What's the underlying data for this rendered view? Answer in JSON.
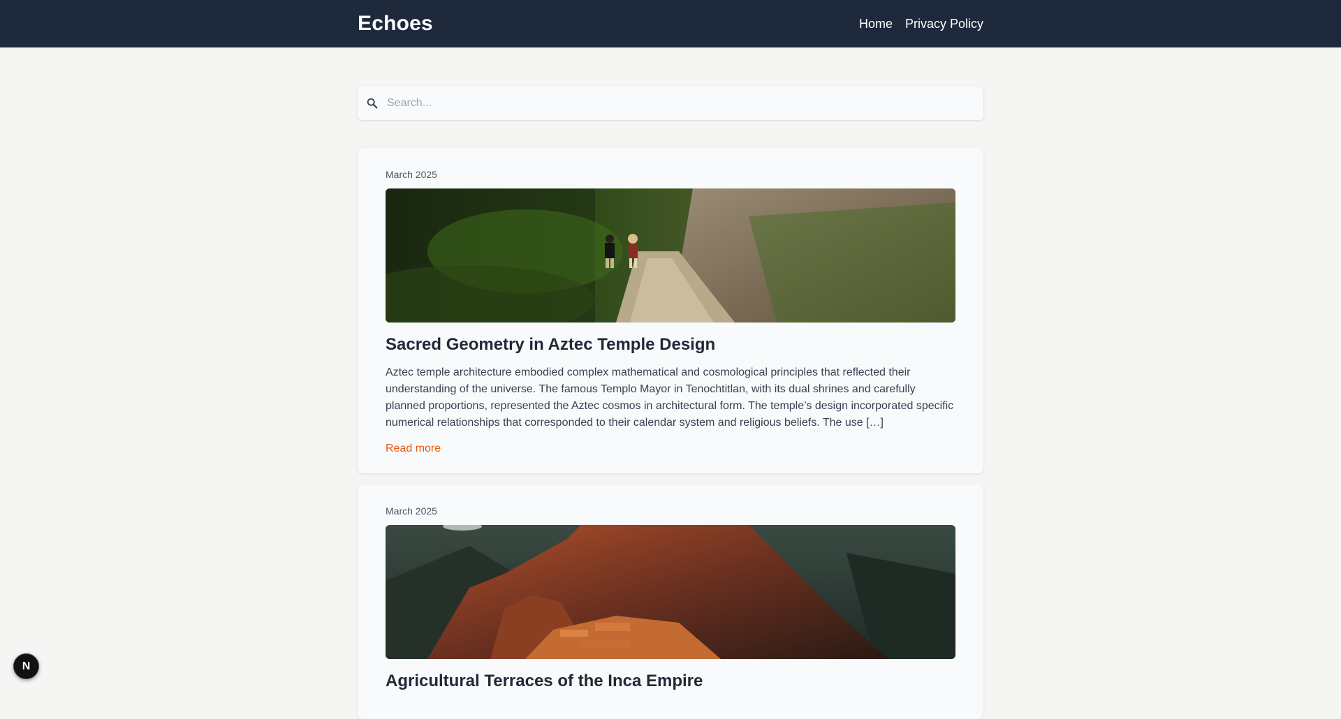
{
  "header": {
    "brand": "Echoes",
    "nav": [
      {
        "label": "Home"
      },
      {
        "label": "Privacy Policy"
      }
    ]
  },
  "search": {
    "placeholder": "Search...",
    "icon": "search-icon"
  },
  "posts": [
    {
      "date": "March 2025",
      "image": "forest-path-image",
      "title": "Sacred Geometry in Aztec Temple Design",
      "excerpt": "Aztec temple architecture embodied complex mathematical and cosmological principles that reflected their understanding of the universe. The famous Templo Mayor in Tenochtitlan, with its dual shrines and carefully planned proportions, represented the Aztec cosmos in architectural form. The temple’s design incorporated specific numerical relationships that corresponded to their calendar system and religious beliefs. The use […]",
      "read_more": "Read more"
    },
    {
      "date": "March 2025",
      "image": "mountain-ruins-image",
      "title": "Agricultural Terraces of the Inca Empire"
    }
  ],
  "fab": {
    "label": "N",
    "icon": "nextjs-icon"
  },
  "colors": {
    "header_bg": "#1e293b",
    "page_bg": "#f5f5f4",
    "card_bg": "#f8fafc",
    "link": "#ea580c"
  }
}
